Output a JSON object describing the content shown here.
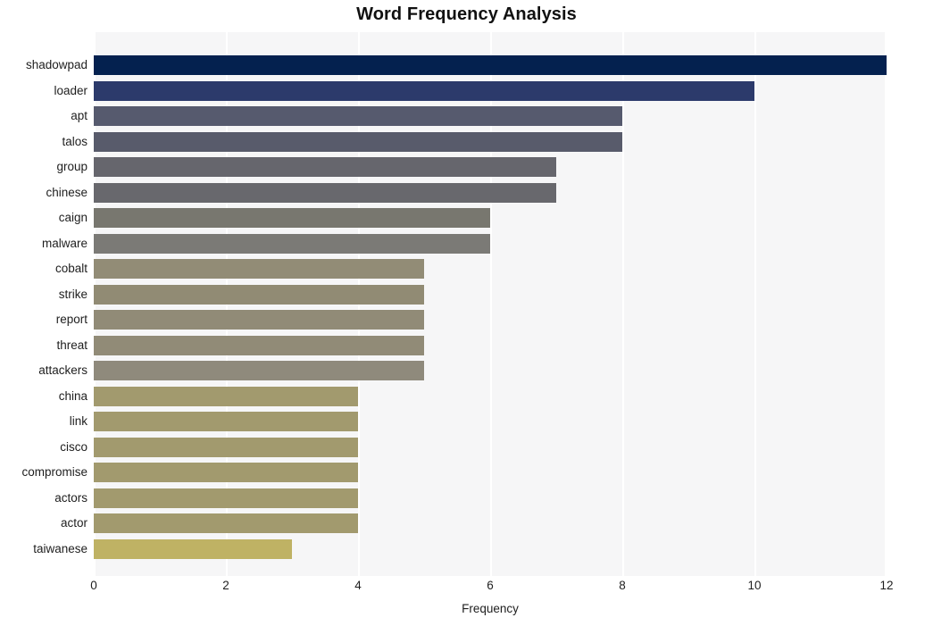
{
  "chart": {
    "title": "Word Frequency Analysis",
    "xlabel": "Frequency",
    "ylabel": ""
  },
  "chart_data": {
    "type": "bar",
    "orientation": "horizontal",
    "title": "Word Frequency Analysis",
    "xlabel": "Frequency",
    "ylabel": "",
    "xlim": [
      0,
      12
    ],
    "xticks": [
      0,
      2,
      4,
      6,
      8,
      10,
      12
    ],
    "xtick_labels": [
      "0",
      "2",
      "4",
      "6",
      "8",
      "10",
      "12"
    ],
    "grid": true,
    "grid_axis": "x",
    "legend": false,
    "plot_background": "#f6f6f7",
    "gridline_color": "#ffffff",
    "categories": [
      "shadowpad",
      "loader",
      "apt",
      "talos",
      "group",
      "chinese",
      "caign",
      "malware",
      "cobalt",
      "strike",
      "report",
      "threat",
      "attackers",
      "china",
      "link",
      "cisco",
      "compromise",
      "actors",
      "actor",
      "taiwanese"
    ],
    "values": [
      12,
      10,
      8,
      8,
      7,
      7,
      6,
      6,
      5,
      5,
      5,
      5,
      5,
      4,
      4,
      4,
      4,
      4,
      4,
      3
    ],
    "bar_colors": [
      "#04214f",
      "#2c3a6b",
      "#565a6e",
      "#585b6b",
      "#66666d",
      "#68686d",
      "#78776f",
      "#7b7a76",
      "#928c76",
      "#918b74",
      "#918b77",
      "#918b77",
      "#8f8a7c",
      "#a29a6e",
      "#a29a6e",
      "#a29a6e",
      "#a29a6e",
      "#a29a6e",
      "#a29a6e",
      "#bfb264"
    ]
  }
}
